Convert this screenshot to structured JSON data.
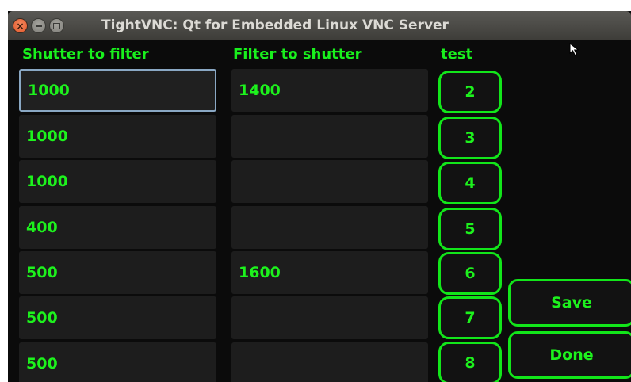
{
  "window": {
    "title": "TightVNC: Qt for Embedded Linux VNC Server",
    "buttons": {
      "close": "×",
      "minimize": "",
      "maximize": ""
    }
  },
  "headers": {
    "shutter_to_filter": "Shutter to filter",
    "filter_to_shutter": "Filter to shutter",
    "test": "test"
  },
  "rows": [
    {
      "shutter_to_filter": "1000",
      "filter_to_shutter": "1400",
      "test_label": "2"
    },
    {
      "shutter_to_filter": "1000",
      "filter_to_shutter": "",
      "test_label": "3"
    },
    {
      "shutter_to_filter": "1000",
      "filter_to_shutter": "",
      "test_label": "4"
    },
    {
      "shutter_to_filter": "400",
      "filter_to_shutter": "",
      "test_label": "5"
    },
    {
      "shutter_to_filter": "500",
      "filter_to_shutter": "1600",
      "test_label": "6"
    },
    {
      "shutter_to_filter": "500",
      "filter_to_shutter": "",
      "test_label": "7"
    },
    {
      "shutter_to_filter": "500",
      "filter_to_shutter": "",
      "test_label": "8"
    }
  ],
  "actions": {
    "save": "Save",
    "done": "Done"
  },
  "colors": {
    "accent_green": "#1df21d",
    "background": "#0b0b0b",
    "field_bg": "#1d1d1d",
    "titlebar": "#3e3d39",
    "focus_border": "#8aa8c4"
  },
  "icons": {
    "cursor": "mouse-pointer-icon"
  }
}
